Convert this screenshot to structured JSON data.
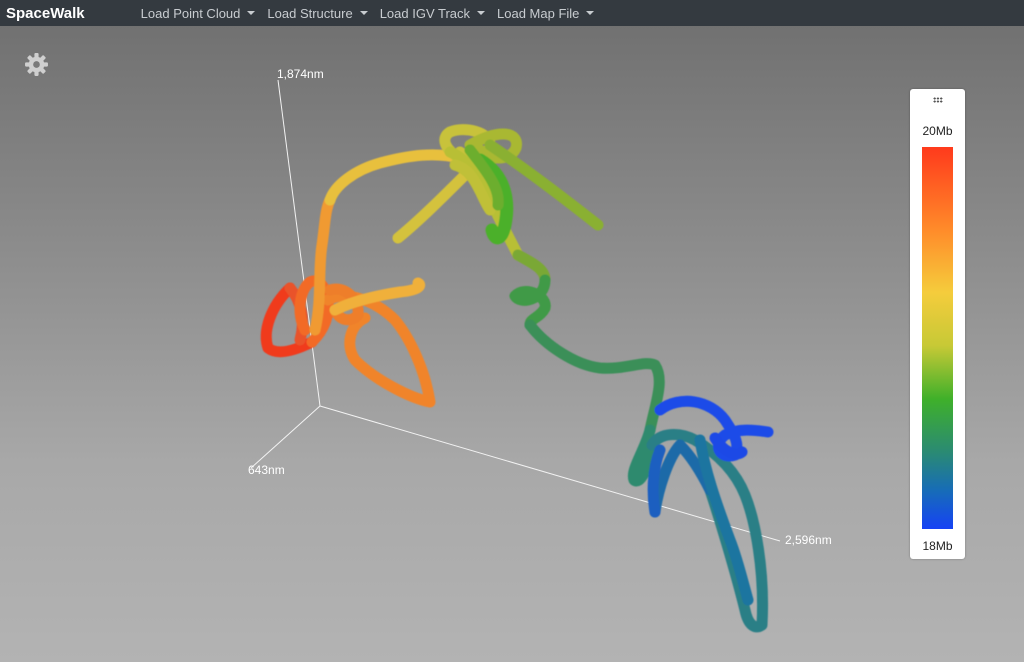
{
  "navbar": {
    "brand": "SpaceWalk",
    "menus": [
      {
        "label": "Load Point Cloud"
      },
      {
        "label": "Load Structure"
      },
      {
        "label": "Load IGV Track"
      },
      {
        "label": "Load Map File"
      }
    ]
  },
  "settings": {
    "icon": "gear-icon"
  },
  "axes": {
    "y_label": "1,874nm",
    "z_label": "643nm",
    "x_label": "2,596nm"
  },
  "legend": {
    "top_label": "20Mb",
    "bottom_label": "18Mb",
    "handle_icon": "drag-handle-icon",
    "colors": [
      "#ff3a1c",
      "#ff8c2a",
      "#f5cc3c",
      "#c7c936",
      "#3fb02a",
      "#2a8a74",
      "#176cb8",
      "#1642f5"
    ]
  }
}
